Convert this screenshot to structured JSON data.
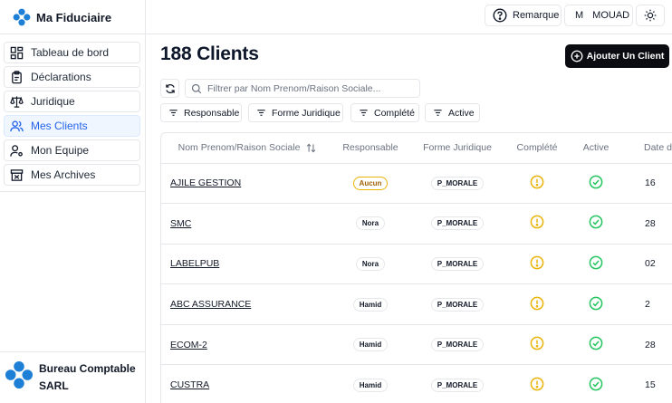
{
  "brand": {
    "title": "Ma Fiduciaire"
  },
  "nav": {
    "items": [
      {
        "label": "Tableau de bord",
        "icon": "dashboard-icon"
      },
      {
        "label": "Déclarations",
        "icon": "clipboard-icon"
      },
      {
        "label": "Juridique",
        "icon": "scale-icon"
      },
      {
        "label": "Mes Clients",
        "icon": "users-icon",
        "active": true
      },
      {
        "label": "Mon Equipe",
        "icon": "user-cog-icon"
      },
      {
        "label": "Mes Archives",
        "icon": "archive-icon"
      }
    ]
  },
  "org": {
    "name": "Bureau Comptable SARL"
  },
  "topbar": {
    "remarque_label": "Remarque",
    "user_initial": "M",
    "user_name": "MOUAD",
    "theme_icon": "sun-icon"
  },
  "main": {
    "title": "188 Clients",
    "add_button": "Ajouter Un Client",
    "search_placeholder": "Filtrer par Nom Prenom/Raison Sociale...",
    "filters": [
      "Responsable",
      "Forme Juridique",
      "Complété",
      "Active"
    ]
  },
  "table": {
    "headers": [
      "Nom Prenom/Raison Sociale",
      "Responsable",
      "Forme Juridique",
      "Complété",
      "Active",
      "Date d"
    ],
    "rows": [
      {
        "name": "AJILE GESTION",
        "responsable": "Aucun",
        "forme": "P_MORALE",
        "complete": "warning",
        "active": "check",
        "date": "16"
      },
      {
        "name": "SMC",
        "responsable": "Nora",
        "forme": "P_MORALE",
        "complete": "warning",
        "active": "check",
        "date": "28"
      },
      {
        "name": "LABELPUB",
        "responsable": "Nora",
        "forme": "P_MORALE",
        "complete": "warning",
        "active": "check",
        "date": "02"
      },
      {
        "name": "ABC ASSURANCE",
        "responsable": "Hamid",
        "forme": "P_MORALE",
        "complete": "warning",
        "active": "check",
        "date": "2"
      },
      {
        "name": "ECOM-2",
        "responsable": "Hamid",
        "forme": "P_MORALE",
        "complete": "warning",
        "active": "check",
        "date": "28"
      },
      {
        "name": "CUSTRA",
        "responsable": "Hamid",
        "forme": "P_MORALE",
        "complete": "warning",
        "active": "check",
        "date": "15"
      }
    ]
  },
  "colors": {
    "accent": "#2563eb",
    "warning": "#eab308",
    "success": "#22c55e",
    "primary_button": "#0b0b12"
  }
}
